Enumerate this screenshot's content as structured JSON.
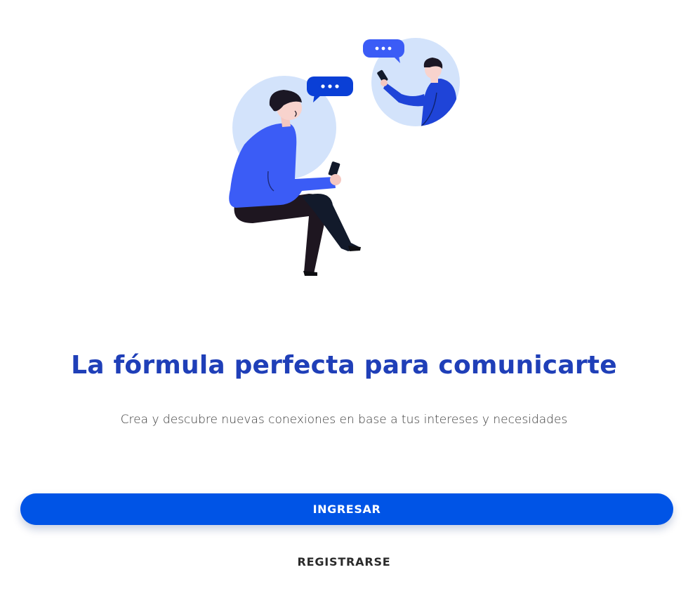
{
  "hero": {
    "illustration": "two-people-chatting-illustration"
  },
  "content": {
    "title": "La fórmula perfecta para comunicarte",
    "subtitle": "Crea y descubre nuevas conexiones en base a tus intereses y necesidades"
  },
  "actions": {
    "login_label": "INGRESAR",
    "register_label": "REGISTRARSE"
  },
  "colors": {
    "title": "#1f3fb8",
    "primary_button": "#0054e6",
    "illustration_blue": "#3b5cf6",
    "illustration_bg": "#d6e4fb",
    "bubble": "#0a3fd6"
  }
}
